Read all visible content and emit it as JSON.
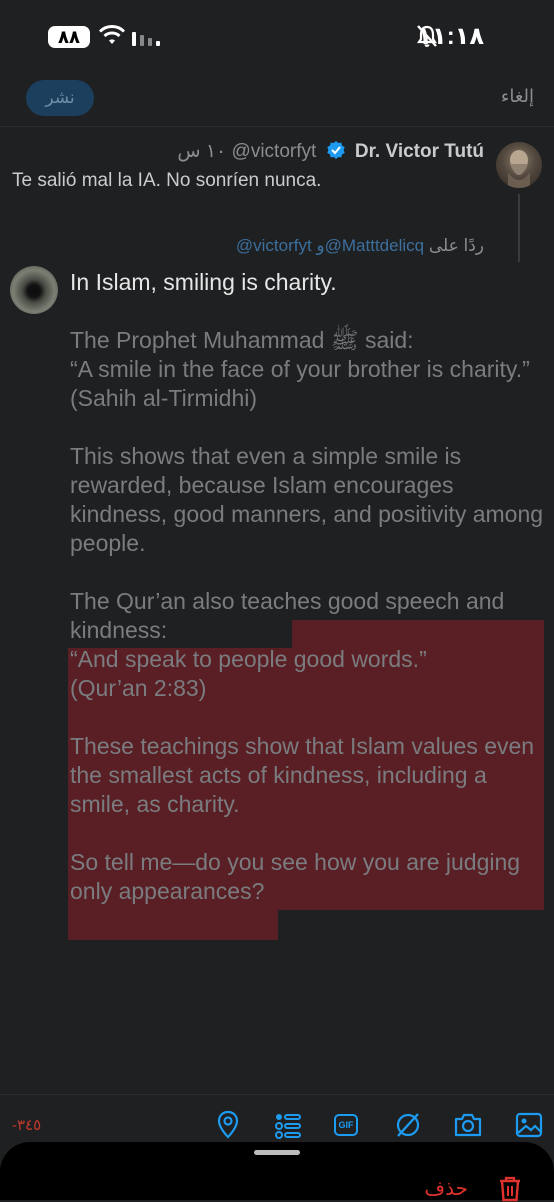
{
  "status_bar": {
    "battery": "٨٨",
    "time": "١١:١٨"
  },
  "header": {
    "cancel_label": "إلغاء",
    "post_label": "نشر"
  },
  "original_post": {
    "author_name": "Dr. Victor Tutú",
    "handle": "@victorfyt",
    "time": "١٠ س",
    "text": "Te salió mal la IA. No sonríen nunca."
  },
  "reply_context": {
    "prefix": "ردًا على",
    "users": "@victorfyt و@Matttdelicq"
  },
  "compose": {
    "first_line": "In Islam, smiling is charity.",
    "body_before_highlight": "\n\nThe Prophet Muhammad ﷺ said:\n“A smile in the face of your brother is charity.”\n(Sahih al-Tirmidhi)\n\nThis shows that even a simple smile is rewarded, because Islam encourages kindness, good manners, and positivity among people.\n\nThe Qur’an also teac",
    "body_highlighted": "hes good speech and kindness:\n“And speak to people good words.”\n(Qur’an 2:83)\n\nThese teachings show that Islam values even the smallest acts of kindness, including a smile, as charity.\n\nSo tell me—do you see how you are judging only appearances?",
    "char_counter": "-٣٤٥"
  },
  "toolbar": {
    "icons": [
      "location-icon",
      "poll-icon",
      "gif-icon",
      "draw-icon",
      "camera-icon",
      "image-icon"
    ],
    "gif_text": "GIF"
  },
  "bottom_sheet": {
    "delete_label": "حذف"
  },
  "colors": {
    "background": "#1f2022",
    "highlight": "#5a1f24",
    "danger": "#e0312d",
    "accent": "#1d9bf0"
  }
}
